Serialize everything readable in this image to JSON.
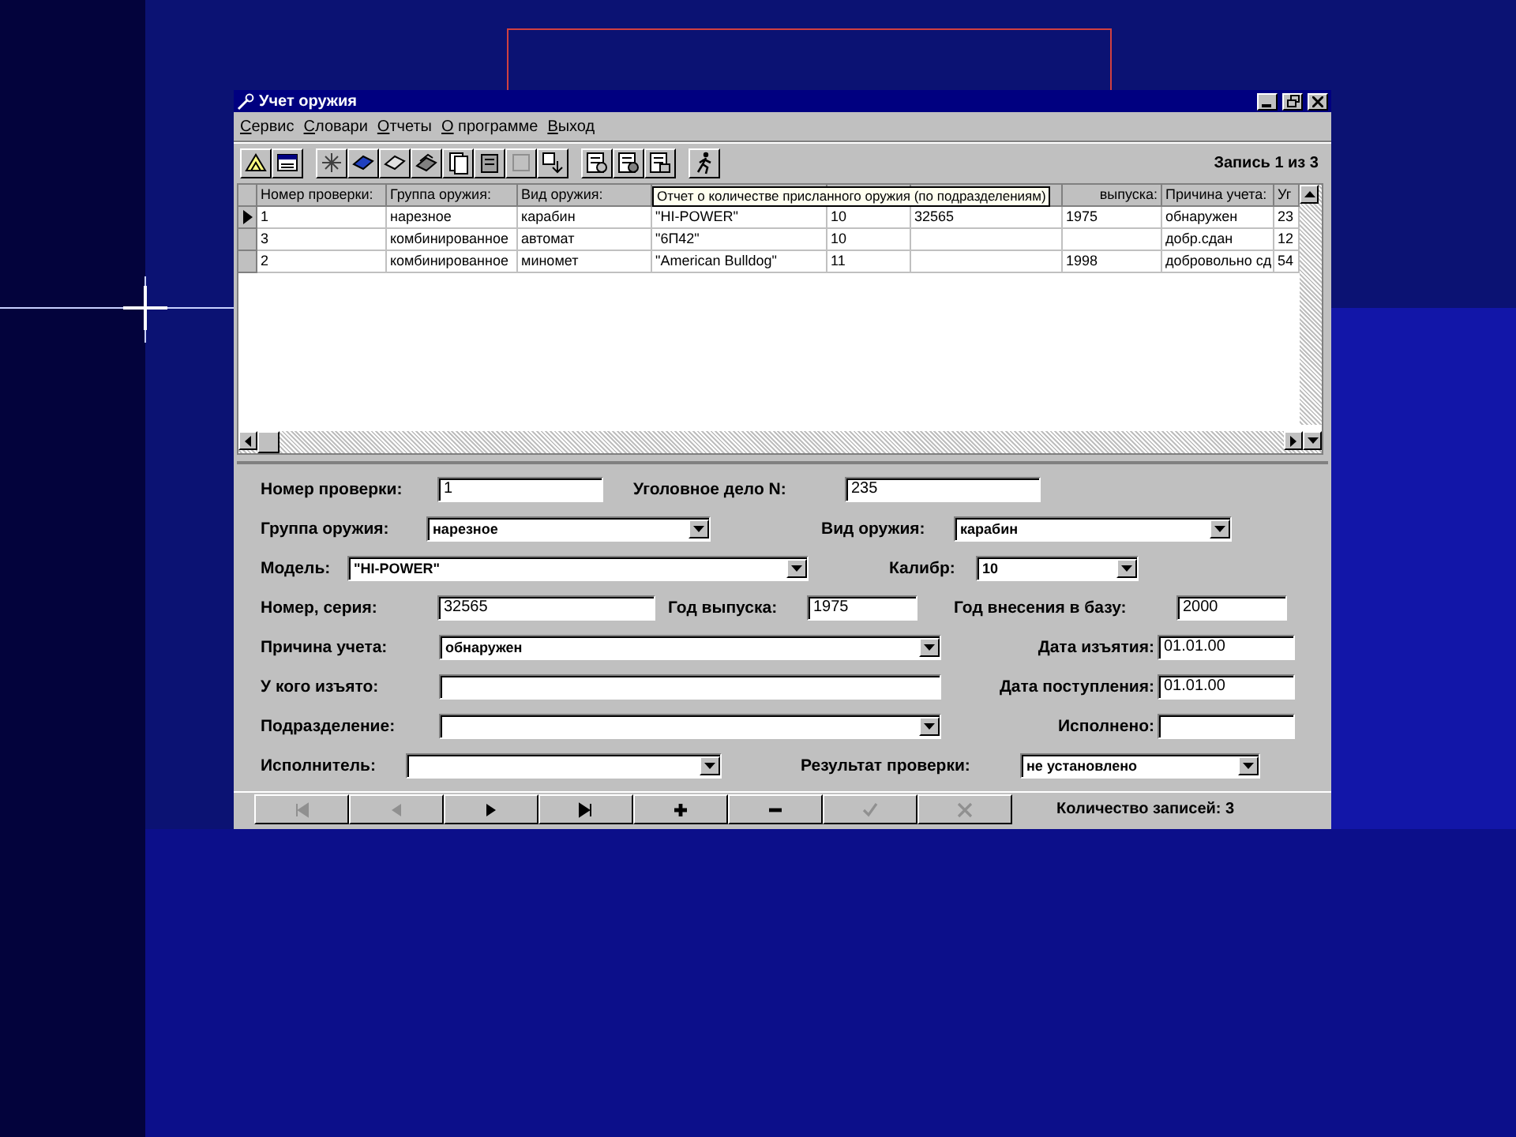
{
  "window": {
    "title": "Учет оружия"
  },
  "menu": [
    "Сервис",
    "Словари",
    "Отчеты",
    "О программе",
    "Выход"
  ],
  "record_position": "Запись 1 из 3",
  "table": {
    "columns": [
      "Номер проверки:",
      "Группа оружия:",
      "Вид оружия:",
      null,
      null,
      null,
      "выпуска:",
      "Причина учета:",
      "Уг"
    ],
    "tooltip": "Отчет о количестве присланного оружия (по подразделениям)",
    "rows": [
      {
        "selected": true,
        "cells": [
          "1",
          "нарезное",
          "карабин",
          "\"HI-POWER\"",
          "10",
          "32565",
          "1975",
          "обнаружен",
          "23"
        ]
      },
      {
        "selected": false,
        "cells": [
          "3",
          "комбинированное",
          "автомат",
          "\"6П42\"",
          "10",
          null,
          null,
          "добр.сдан",
          "12"
        ]
      },
      {
        "selected": false,
        "cells": [
          "2",
          "комбинированное",
          "миномет",
          "\"American Bulldog\"",
          "11",
          null,
          "1998",
          "добровольно сд",
          "54"
        ]
      }
    ]
  },
  "form": [
    [
      {
        "label": "Номер проверки:",
        "kind": "text",
        "value": "1"
      },
      {
        "label": "Уголовное дело N:",
        "kind": "text",
        "value": "235"
      }
    ],
    [
      {
        "label": "Группа оружия:",
        "kind": "combo",
        "value": "нарезное"
      },
      {
        "label": "Вид оружия:",
        "kind": "combo",
        "value": "карабин"
      }
    ],
    [
      {
        "label": "Модель:",
        "kind": "combo",
        "value": "\"HI-POWER\""
      },
      {
        "label": "Калибр:",
        "kind": "combo",
        "value": "10"
      }
    ],
    [
      {
        "label": "Номер, серия:",
        "kind": "text",
        "value": "32565"
      },
      {
        "label": "Год выпуска:",
        "kind": "text",
        "value": "1975"
      },
      {
        "label": "Год внесения в базу:",
        "kind": "text",
        "value": "2000"
      }
    ],
    [
      {
        "label": "Причина учета:",
        "kind": "combo",
        "value": "обнаружен"
      },
      {
        "label": "Дата изъятия:",
        "kind": "text",
        "value": "01.01.00"
      }
    ],
    [
      {
        "label": "У кого изъято:",
        "kind": "text"
      },
      {
        "label": "Дата поступления:",
        "kind": "text",
        "value": "01.01.00"
      }
    ],
    [
      {
        "label": "Подразделение:",
        "kind": "combo"
      },
      {
        "label": "Исполнено:",
        "kind": "text"
      }
    ],
    [
      {
        "label": "Исполнитель:",
        "kind": "combo"
      },
      {
        "label": "Результат проверки:",
        "kind": "combo",
        "value": "не установлено"
      }
    ]
  ],
  "navigator": [
    {
      "kind": "first",
      "disabled": true
    },
    {
      "kind": "prior",
      "disabled": true
    },
    {
      "kind": "next",
      "disabled": false
    },
    {
      "kind": "last",
      "disabled": false
    },
    {
      "kind": "insert",
      "disabled": false
    },
    {
      "kind": "delete",
      "disabled": false
    },
    {
      "kind": "post",
      "disabled": true
    },
    {
      "kind": "cancel",
      "disabled": true
    }
  ],
  "status_bar": "Количество записей: 3"
}
